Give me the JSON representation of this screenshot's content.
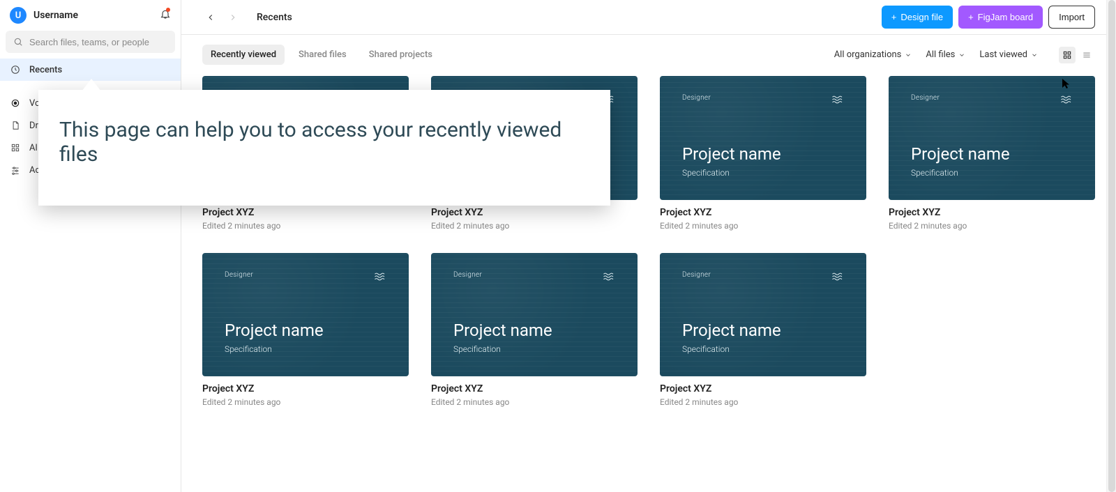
{
  "user": {
    "initial": "U",
    "name": "Username"
  },
  "search": {
    "placeholder": "Search files, teams, or people"
  },
  "sidebar": {
    "recents": "Recents",
    "items": [
      {
        "label": "Vo"
      },
      {
        "label": "Dr"
      },
      {
        "label": "Al"
      },
      {
        "label": "Ac"
      }
    ]
  },
  "header": {
    "title": "Recents",
    "buttons": {
      "design": "Design file",
      "figjam": "FigJam board",
      "import": "Import"
    }
  },
  "tabs": [
    {
      "label": "Recently viewed",
      "active": true
    },
    {
      "label": "Shared files",
      "active": false
    },
    {
      "label": "Shared projects",
      "active": false
    }
  ],
  "filters": {
    "org": "All organizations",
    "files": "All files",
    "sort": "Last viewed"
  },
  "thumb": {
    "designer": "Designer",
    "title": "Project name",
    "sub": "Specification"
  },
  "cards": [
    {
      "title": "Project XYZ",
      "sub": "Edited 2 minutes ago"
    },
    {
      "title": "Project XYZ",
      "sub": "Edited 2 minutes ago"
    },
    {
      "title": "Project XYZ",
      "sub": "Edited 2 minutes ago"
    },
    {
      "title": "Project XYZ",
      "sub": "Edited 2 minutes ago"
    },
    {
      "title": "Project XYZ",
      "sub": "Edited 2 minutes ago"
    },
    {
      "title": "Project XYZ",
      "sub": "Edited 2 minutes ago"
    },
    {
      "title": "Project XYZ",
      "sub": "Edited 2 minutes ago"
    }
  ],
  "callout": "This page can help you to access your recently viewed files"
}
